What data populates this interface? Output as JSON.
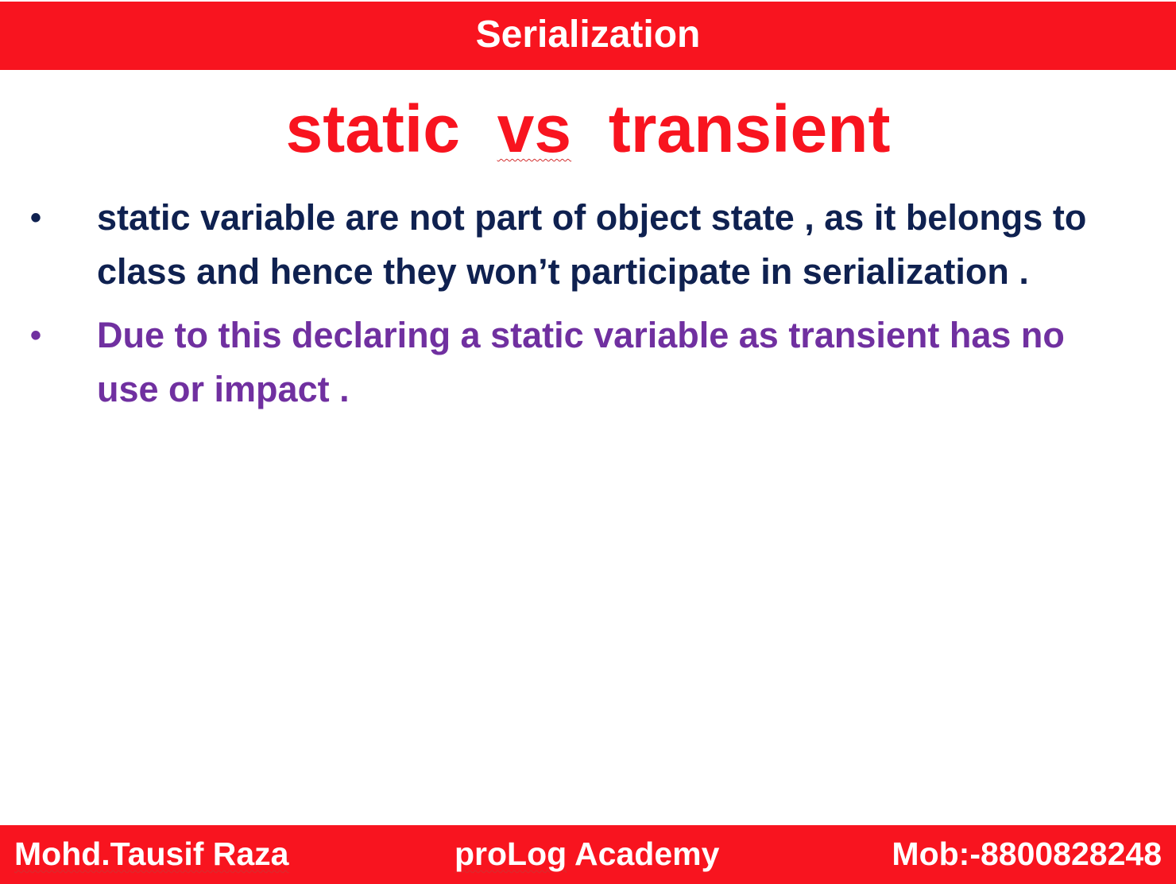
{
  "header": {
    "title": "Serialization"
  },
  "slide": {
    "title_part1": "static  ",
    "title_part2": "vs",
    "title_part3": "  transient"
  },
  "bullets": [
    {
      "text": "static variable are not part of object state , as it belongs to class and hence they won’t participate in serialization .",
      "color": "#0f2150"
    },
    {
      "text": "Due to this declaring a static variable as transient has no use or impact .",
      "color": "#7030a0"
    }
  ],
  "bullet_symbol": "•",
  "footer": {
    "author": "Mohd.Tausif Raza",
    "academy_part1": "proLog",
    "academy_part2": " Academy",
    "mobile": "Mob:-8800828248"
  },
  "colors": {
    "accent_red": "#f8141f",
    "navy": "#0f2150",
    "purple": "#7030a0"
  }
}
